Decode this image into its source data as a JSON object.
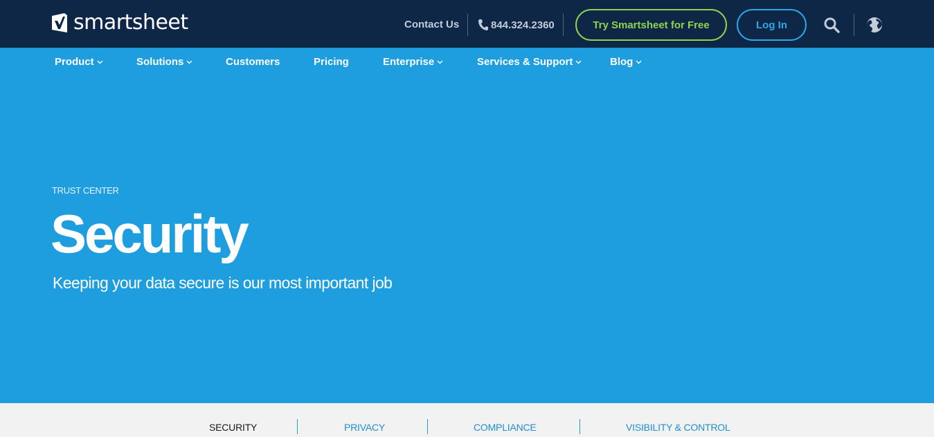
{
  "brand": {
    "name": "smartsheet"
  },
  "header": {
    "contact_label": "Contact Us",
    "phone": "844.324.2360",
    "try_label": "Try Smartsheet for Free",
    "login_label": "Log In",
    "icons": [
      "phone-icon",
      "search-icon",
      "globe-icon"
    ]
  },
  "nav": {
    "items": [
      {
        "label": "Product",
        "dropdown": true
      },
      {
        "label": "Solutions",
        "dropdown": true
      },
      {
        "label": "Customers",
        "dropdown": false
      },
      {
        "label": "Pricing",
        "dropdown": false
      },
      {
        "label": "Enterprise",
        "dropdown": true
      },
      {
        "label": "Services & Support",
        "dropdown": true
      },
      {
        "label": "Blog",
        "dropdown": true
      }
    ]
  },
  "hero": {
    "eyebrow": "TRUST CENTER",
    "title": "Security",
    "subtitle": "Keeping your data secure is our most important job"
  },
  "subtabs": {
    "items": [
      {
        "label": "SECURITY",
        "active": true
      },
      {
        "label": "PRIVACY",
        "active": false
      },
      {
        "label": "COMPLIANCE",
        "active": false
      },
      {
        "label": "VISIBILITY & CONTROL",
        "active": false
      }
    ]
  },
  "colors": {
    "header_bg": "#0f2747",
    "hero_blue": "#1e9ddf",
    "try_green": "#8fd44c",
    "login_blue": "#2ea7e8",
    "subtabs_bg": "#f2f2f2"
  }
}
